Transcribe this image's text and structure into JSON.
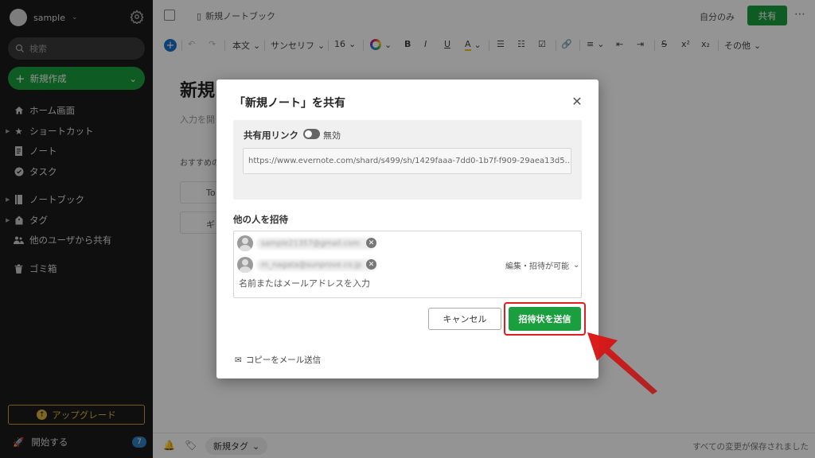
{
  "sidebar": {
    "account_name": "sample",
    "search_placeholder": "検索",
    "new_label": "新規作成",
    "items": [
      {
        "label": "ホーム画面"
      },
      {
        "label": "ショートカット"
      },
      {
        "label": "ノート"
      },
      {
        "label": "タスク"
      },
      {
        "label": "ノートブック"
      },
      {
        "label": "タグ"
      },
      {
        "label": "他のユーザから共有"
      },
      {
        "label": "ゴミ箱"
      }
    ],
    "upgrade_label": "アップグレード",
    "start_label": "開始する",
    "start_badge": "7"
  },
  "topbar": {
    "notebook_label": "新規ノートブック",
    "only_me": "自分のみ",
    "share_label": "共有"
  },
  "toolbar": {
    "body_text": "本文",
    "font": "サンセリフ",
    "size": "16",
    "bold": "B",
    "italic": "I",
    "underline": "U",
    "highlight": "A",
    "superscript": "x²",
    "subscript": "x₂",
    "more": "その他"
  },
  "note": {
    "title_partial": "新規",
    "placeholder_partial": "入力を開",
    "recommend_partial": "おすすめの",
    "tpl1": "To",
    "tpl2": "ギ"
  },
  "bottombar": {
    "tag_label": "新規タグ",
    "saved_text": "すべての変更が保存されました"
  },
  "modal": {
    "title": "「新規ノート」を共有",
    "link_label": "共有用リンク",
    "link_state": "無効",
    "url": "https://www.evernote.com/shard/s499/sh/1429faaa-7dd0-1b7f-f909-29aea13d5...",
    "invite_label": "他の人を招待",
    "invitees": [
      {
        "email": "sample21357@gmail.com"
      },
      {
        "email": "m_nagata@sunprove.co.jp"
      }
    ],
    "permission": "編集・招待が可能",
    "name_placeholder": "名前またはメールアドレスを入力",
    "cancel_label": "キャンセル",
    "send_label": "招待状を送信",
    "copy_mail_label": "コピーをメール送信"
  },
  "colors": {
    "brand_green": "#1b9e3e",
    "highlight_red": "#e02020",
    "sidebar_bg": "#1a1a1a",
    "upgrade_gold": "#d8b23c"
  }
}
